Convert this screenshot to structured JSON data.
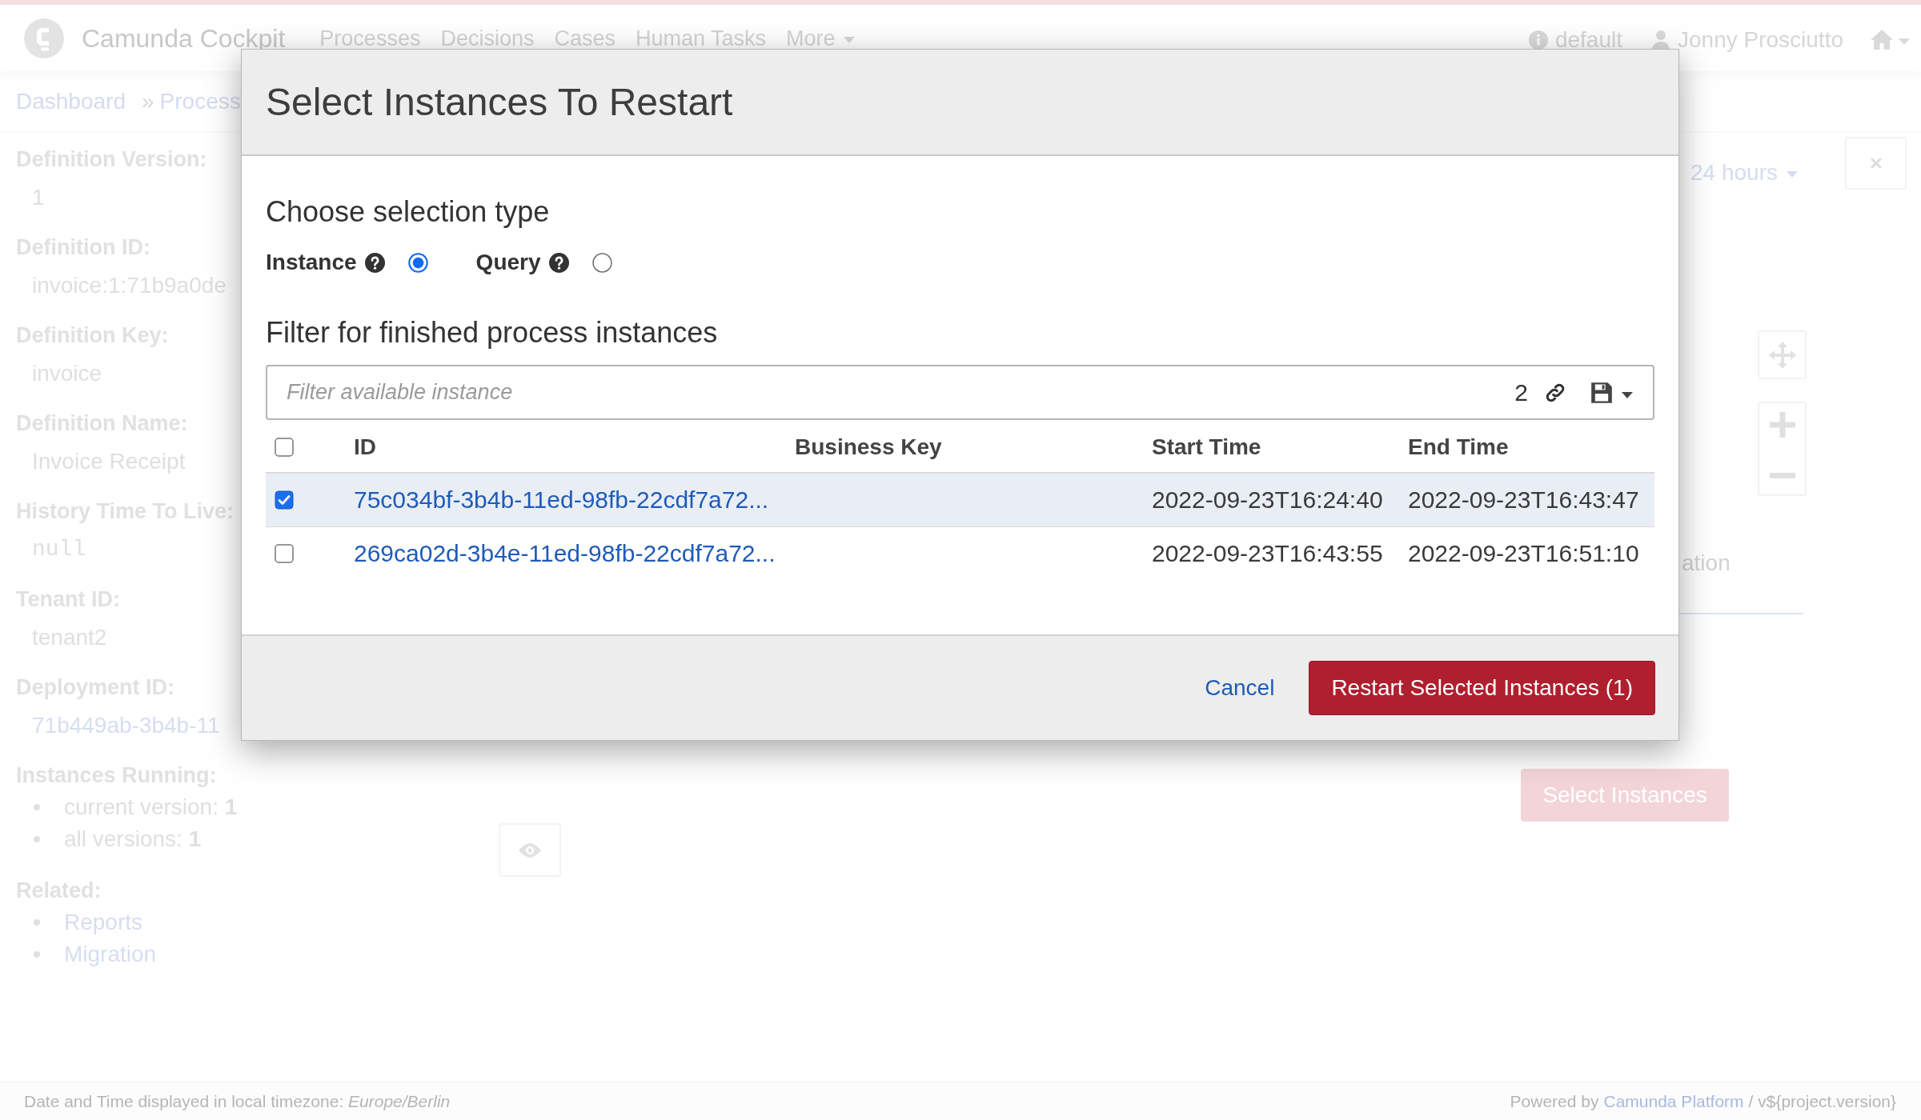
{
  "top_bar": {
    "title": "Camunda Cockpit",
    "nav": [
      {
        "label": "Processes",
        "dropdown": false
      },
      {
        "label": "Decisions",
        "dropdown": false
      },
      {
        "label": "Cases",
        "dropdown": false
      },
      {
        "label": "Human Tasks",
        "dropdown": false
      },
      {
        "label": "More",
        "dropdown": true
      }
    ],
    "engine": "default",
    "user": "Jonny Prosciutto"
  },
  "breadcrumbs": {
    "items": [
      "Dashboard",
      "Process"
    ],
    "separator": "»"
  },
  "sidebar": [
    {
      "kind": "text",
      "label": "Definition Version:",
      "value": "1"
    },
    {
      "kind": "text",
      "label": "Definition ID:",
      "value": "invoice:1:71b9a0de"
    },
    {
      "kind": "text",
      "label": "Definition Key:",
      "value": "invoice"
    },
    {
      "kind": "text",
      "label": "Definition Name:",
      "value": "Invoice Receipt"
    },
    {
      "kind": "code",
      "label": "History Time To Live:",
      "value": "null"
    },
    {
      "kind": "text",
      "label": "Tenant ID:",
      "value": "tenant2"
    },
    {
      "kind": "link",
      "label": "Deployment ID:",
      "value": "71b449ab-3b4b-11"
    },
    {
      "kind": "list",
      "label": "Instances Running:",
      "items": [
        "current version: **1**",
        "all versions: **1**"
      ]
    },
    {
      "kind": "links",
      "label": "Related:",
      "items": [
        "Reports",
        "Migration"
      ]
    }
  ],
  "background": {
    "time_range": "24 hours",
    "tab": "ation",
    "select_button": "Select Instances"
  },
  "modal": {
    "title": "Select Instances To Restart",
    "selection_heading": "Choose selection type",
    "selection_options": [
      {
        "label": "Instance",
        "selected": true
      },
      {
        "label": "Query",
        "selected": false
      }
    ],
    "filter_heading": "Filter for finished process instances",
    "filter": {
      "placeholder": "Filter available instance",
      "count": "2"
    },
    "table": {
      "all_checked": false,
      "columns": [
        "ID",
        "Business Key",
        "Start Time",
        "End Time"
      ],
      "rows": [
        {
          "selected": true,
          "checked": true,
          "id": "75c034bf-3b4b-11ed-98fb-22cdf7a72...",
          "start_time": "2022-09-23T16:24:40",
          "end_time": "2022-09-23T16:43:47"
        },
        {
          "selected": false,
          "checked": false,
          "id": "269ca02d-3b4e-11ed-98fb-22cdf7a72...",
          "start_time": "2022-09-23T16:43:55",
          "end_time": "2022-09-23T16:51:10"
        }
      ]
    },
    "cancel": "Cancel",
    "confirm": "Restart Selected Instances (1)"
  },
  "footer": {
    "timezone_note": "Date and Time displayed in local timezone: *Europe/Berlin*",
    "powered_by": {
      "prefix": "Powered by",
      "link": "Camunda Platform",
      "suffix": "/ v${project.version}"
    }
  }
}
